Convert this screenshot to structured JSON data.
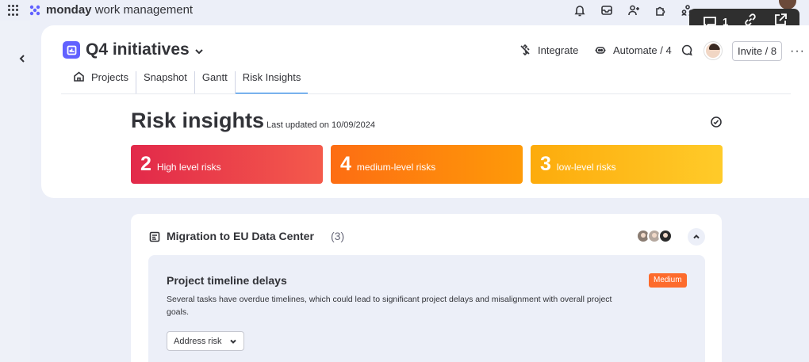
{
  "app": {
    "brand": "monday",
    "product": "work management"
  },
  "float_bar": {
    "comments_count": "1"
  },
  "board": {
    "title": "Q4 initiatives",
    "actions": {
      "integrate": "Integrate",
      "automate": "Automate / 4",
      "invite": "Invite / 8",
      "more": "···"
    },
    "tabs": [
      {
        "label": "Projects"
      },
      {
        "label": "Snapshot"
      },
      {
        "label": "Gantt"
      },
      {
        "label": "Risk Insights",
        "active": true
      }
    ]
  },
  "risk_insights": {
    "title": "Risk insights",
    "last_updated": "Last updated on 10/09/2024",
    "cards": [
      {
        "count": "2",
        "label": "High level risks",
        "color": "#e2294a"
      },
      {
        "count": "4",
        "label": "medium-level risks",
        "color": "#fd6d13"
      },
      {
        "count": "3",
        "label": "low-level risks",
        "color": "#fdab0c"
      }
    ]
  },
  "project": {
    "title": "Migration to EU Data Center",
    "count": "(3)",
    "risk": {
      "title": "Project timeline delays",
      "severity": "Medium",
      "severity_color": "#fd6b2c",
      "description": "Several tasks have overdue timelines, which could lead to significant project delays and misalignment with overall project goals.",
      "action_label": "Address risk"
    }
  }
}
